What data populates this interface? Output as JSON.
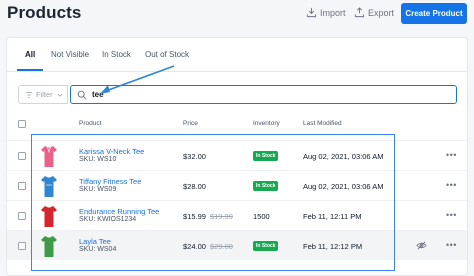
{
  "header": {
    "title": "Products",
    "import_label": "Import",
    "export_label": "Export",
    "create_label": "Create Product"
  },
  "tabs": [
    "All",
    "Not Visible",
    "In Stock",
    "Out of Stock"
  ],
  "filter": {
    "label": "Filter"
  },
  "search": {
    "value": "tee",
    "placeholder": ""
  },
  "table": {
    "columns": [
      "Product",
      "Price",
      "Inventory",
      "Last Modified"
    ],
    "rows": [
      {
        "name": "Karissa V-Neck Tee",
        "sku": "SKU: WS10",
        "price": "$32.00",
        "compare_price": "",
        "inventory": "In Stock",
        "modified": "Aug 02, 2021, 03:06 AM",
        "shirt_color": "#e8628c"
      },
      {
        "name": "Tiffany Fitness Tee",
        "sku": "SKU: WS09",
        "price": "$28.00",
        "compare_price": "",
        "inventory": "In Stock",
        "modified": "Aug 02, 2021, 03:06 AM",
        "shirt_color": "#2f86d1"
      },
      {
        "name": "Endurance Running Tee",
        "sku": "SKU: KWIOS1234",
        "price": "$15.99",
        "compare_price": "$19.99",
        "inventory": "1500",
        "modified": "Feb 11, 12:11 PM",
        "shirt_color": "#d3262e"
      },
      {
        "name": "Layla Tee",
        "sku": "SKU: WS04",
        "price": "$24.00",
        "compare_price": "$29.00",
        "inventory": "In Stock",
        "modified": "Feb 11, 12:12 PM",
        "shirt_color": "#3f9a4a"
      }
    ]
  },
  "colors": {
    "accent": "#1473e6",
    "in_stock": "#17a852"
  }
}
